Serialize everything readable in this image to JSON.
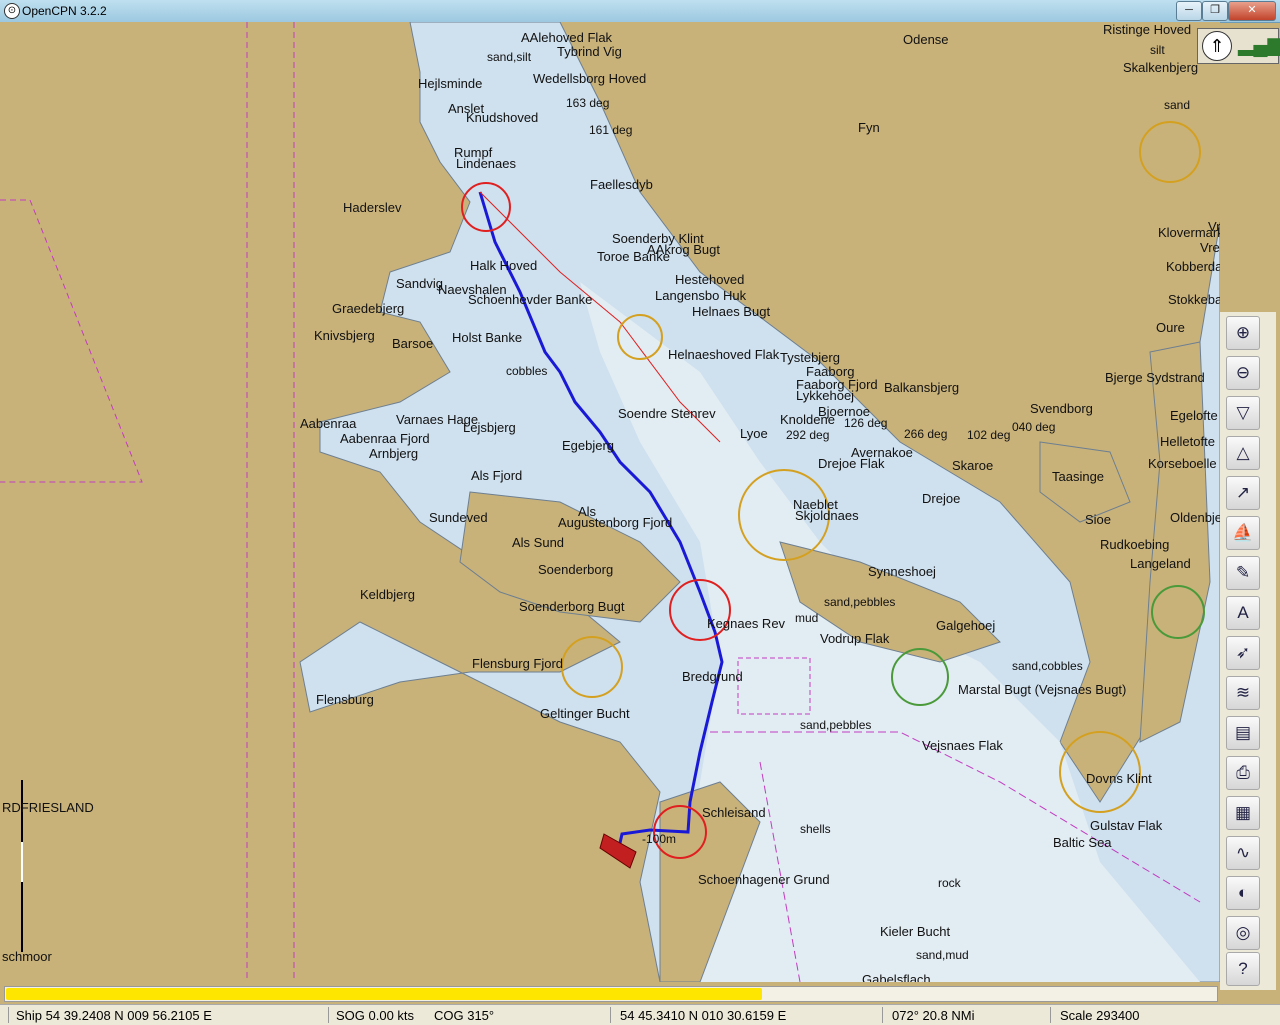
{
  "window": {
    "title": "OpenCPN 3.2.2",
    "min_symbol": "─",
    "max_symbol": "❐",
    "close_symbol": "✕"
  },
  "chart": {
    "place_labels": [
      "Odense",
      "Fyn",
      "Haderslev",
      "Aabenraa",
      "Aabenraa Fjord",
      "Flensburg",
      "Flensburg Fjord",
      "Soenderborg",
      "Soenderborg Bugt",
      "Als",
      "Als Fjord",
      "Als Sund",
      "Augustenborg Fjord",
      "Geltinger Bucht",
      "Schoenhagener Grund",
      "Kieler Bucht",
      "Baltic Sea",
      "Marstal Bugt (Vejsnaes Bugt)",
      "Vejsnaes Flak",
      "Svendborg",
      "Faaborg",
      "Faaborg Fjord",
      "Helnaes Bugt",
      "Langensbo Huk",
      "Taasinge",
      "Drejoe",
      "Skaroe",
      "Avernakoe",
      "Lyoe",
      "Langeland",
      "Sioe",
      "Rudkoebing",
      "Gabelsflach",
      "Skjoldnaes",
      "Naeblet",
      "Synneshoej",
      "Ristinge Hoved",
      "Skalkenbjerg",
      "AAlehoved Flak",
      "Tybrind Vig",
      "Wedellsborg Hoved",
      "Halk Hoved",
      "Sandvig",
      "Graedebjerg",
      "Knivsbjerg",
      "Barsoe",
      "Holst Banke",
      "Varnaes Hage",
      "Lejsbjerg",
      "Arnbjerg",
      "Sundeved",
      "Keldbjerg",
      "Gulstav Flak",
      "Dovns Klint",
      "Bjerge Sydstrand",
      "Helnaeshoved Flak",
      "Soenderby Klint",
      "AAkrog Bugt",
      "Toroe Banke",
      "Schoenhevder Banke",
      "Naevshalen",
      "Egelofte",
      "Helletofte",
      "Korseboelle",
      "Oldenbjerg",
      "Kobberdam",
      "Stokkebakke",
      "Oure",
      "Klovermark",
      "Vresen",
      "Vresen N-Flak",
      "Vodrup Flak",
      "Bredgrund",
      "Schleisand",
      "RDFRIESLAND",
      "schmoor",
      "Soendre Stenrev",
      "Egebjerg",
      "Kegnaes Rev",
      "Faellesdyb",
      "Hejlsminde",
      "Anslet",
      "Knudshoved",
      "Lindenaes",
      "Rumpf",
      "Balkansbjerg",
      "Lykkehoej",
      "Bjoernoe",
      "Knoldene",
      "Hestehoved",
      "Tystebjerg",
      "Galgehoej",
      "Drejoe Flak"
    ],
    "depth_labels": [
      "sand,silt",
      "sand",
      "mud",
      "rock",
      "shells",
      "sand,pebbles",
      "sand,cobbles",
      "sand,mud",
      "cobbles",
      "sand,pebbles",
      "silt",
      "-100m"
    ],
    "bearing_labels": [
      "163 deg",
      "161 deg",
      "126 deg",
      "266 deg",
      "102 deg",
      "292 deg",
      "040 deg"
    ]
  },
  "compass": {
    "needle_icon": "compass-north-icon",
    "gps_icon": "gps-signal-icon"
  },
  "toolbar": [
    {
      "name": "zoom-in-button",
      "icon": "zoom-in-icon",
      "glyph": "⊕"
    },
    {
      "name": "zoom-out-button",
      "icon": "zoom-out-icon",
      "glyph": "⊖"
    },
    {
      "name": "scale-in-button",
      "icon": "funnel-down-icon",
      "glyph": "▽"
    },
    {
      "name": "scale-out-button",
      "icon": "funnel-up-icon",
      "glyph": "△"
    },
    {
      "name": "route-button",
      "icon": "route-icon",
      "glyph": "↗"
    },
    {
      "name": "follow-ship-button",
      "icon": "ship-icon",
      "glyph": "⛵"
    },
    {
      "name": "settings-button",
      "icon": "wrench-icon",
      "glyph": "✎"
    },
    {
      "name": "text-button",
      "icon": "text-font-icon",
      "glyph": "A"
    },
    {
      "name": "current-button",
      "icon": "current-arrow-icon",
      "glyph": "➶"
    },
    {
      "name": "tide-button",
      "icon": "tide-icon",
      "glyph": "≋"
    },
    {
      "name": "color-scheme-button",
      "icon": "color-scheme-icon",
      "glyph": "▤"
    },
    {
      "name": "print-button",
      "icon": "printer-icon",
      "glyph": "⎙"
    },
    {
      "name": "route-manager-button",
      "icon": "route-manager-icon",
      "glyph": "▦"
    },
    {
      "name": "track-button",
      "icon": "track-icon",
      "glyph": "∿"
    },
    {
      "name": "day-night-button",
      "icon": "sunset-icon",
      "glyph": "◐"
    },
    {
      "name": "mob-button",
      "icon": "lifebuoy-icon",
      "glyph": "◎"
    },
    {
      "name": "help-button",
      "icon": "help-icon",
      "glyph": "?"
    }
  ],
  "progress": {
    "value_fraction": 0.625,
    "color": "#ffe600"
  },
  "statusbar": {
    "ship": "Ship 54 39.2408 N   009 56.2105 E",
    "sog": "SOG 0.00 kts",
    "cog": "COG 315°",
    "cursor": "54 45.3410 N   010 30.6159 E",
    "bearing_dist": "072°  20.8 NMi",
    "scale": "Scale 293400"
  },
  "colors": {
    "land": "#c9b27a",
    "water_shallow": "#cfe0ee",
    "water_deep": "#dfeaf2",
    "track": "#1a1ad6",
    "route": "#e02020",
    "magenta": "#c23cc2"
  }
}
